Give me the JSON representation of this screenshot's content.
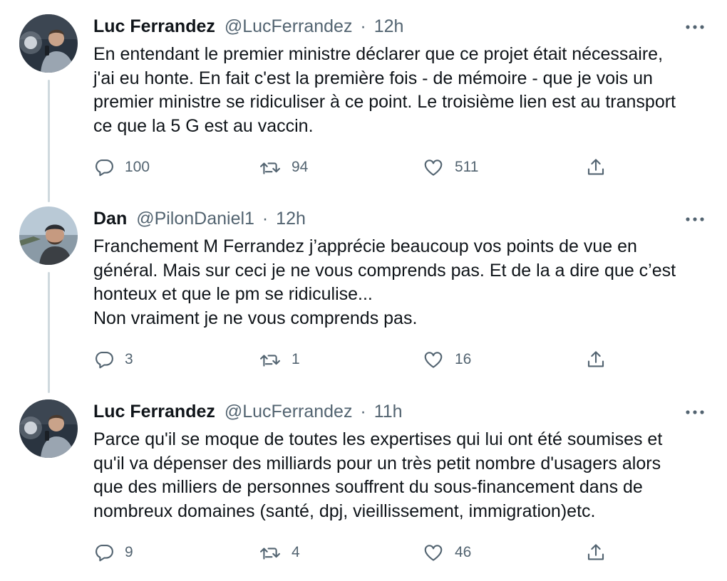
{
  "tweets": [
    {
      "name": "Luc Ferrandez",
      "handle": "@LucFerrandez",
      "sep": "·",
      "time": "12h",
      "lines": [
        "En entendant le premier ministre déclarer que ce projet était nécessaire,",
        "j'ai eu honte. En fait c'est la première fois - de mémoire - que je vois un",
        "premier ministre se ridiculiser à ce point. Le troisième lien est au transport",
        "ce que la 5 G est au vaccin."
      ],
      "replies": "100",
      "retweets": "94",
      "likes": "511"
    },
    {
      "name": "Dan",
      "handle": "@PilonDaniel1",
      "sep": "·",
      "time": "12h",
      "lines": [
        "Franchement M Ferrandez j’apprécie beaucoup vos points de vue en",
        "général. Mais sur ceci je ne vous comprends pas. Et de la a dire que c’est",
        "honteux et que le pm se ridiculise...",
        "Non vraiment je ne vous comprends pas."
      ],
      "replies": "3",
      "retweets": "1",
      "likes": "16"
    },
    {
      "name": "Luc Ferrandez",
      "handle": "@LucFerrandez",
      "sep": "·",
      "time": "11h",
      "lines": [
        "Parce qu'il se moque de toutes les expertises qui lui ont été soumises et",
        "qu'il va dépenser des milliards pour un très petit nombre d'usagers alors",
        "que des milliers de personnes souffrent du sous-financement dans de",
        "nombreux domaines (santé, dpj, vieillissement, immigration)etc."
      ],
      "replies": "9",
      "retweets": "4",
      "likes": "46"
    }
  ],
  "icons": {
    "reply": "reply-icon",
    "retweet": "retweet-icon",
    "like": "heart-icon",
    "share": "share-icon",
    "more": "more-icon"
  },
  "colors": {
    "text": "#0f1419",
    "secondary": "#536471",
    "thread_line": "#cfd9de"
  }
}
